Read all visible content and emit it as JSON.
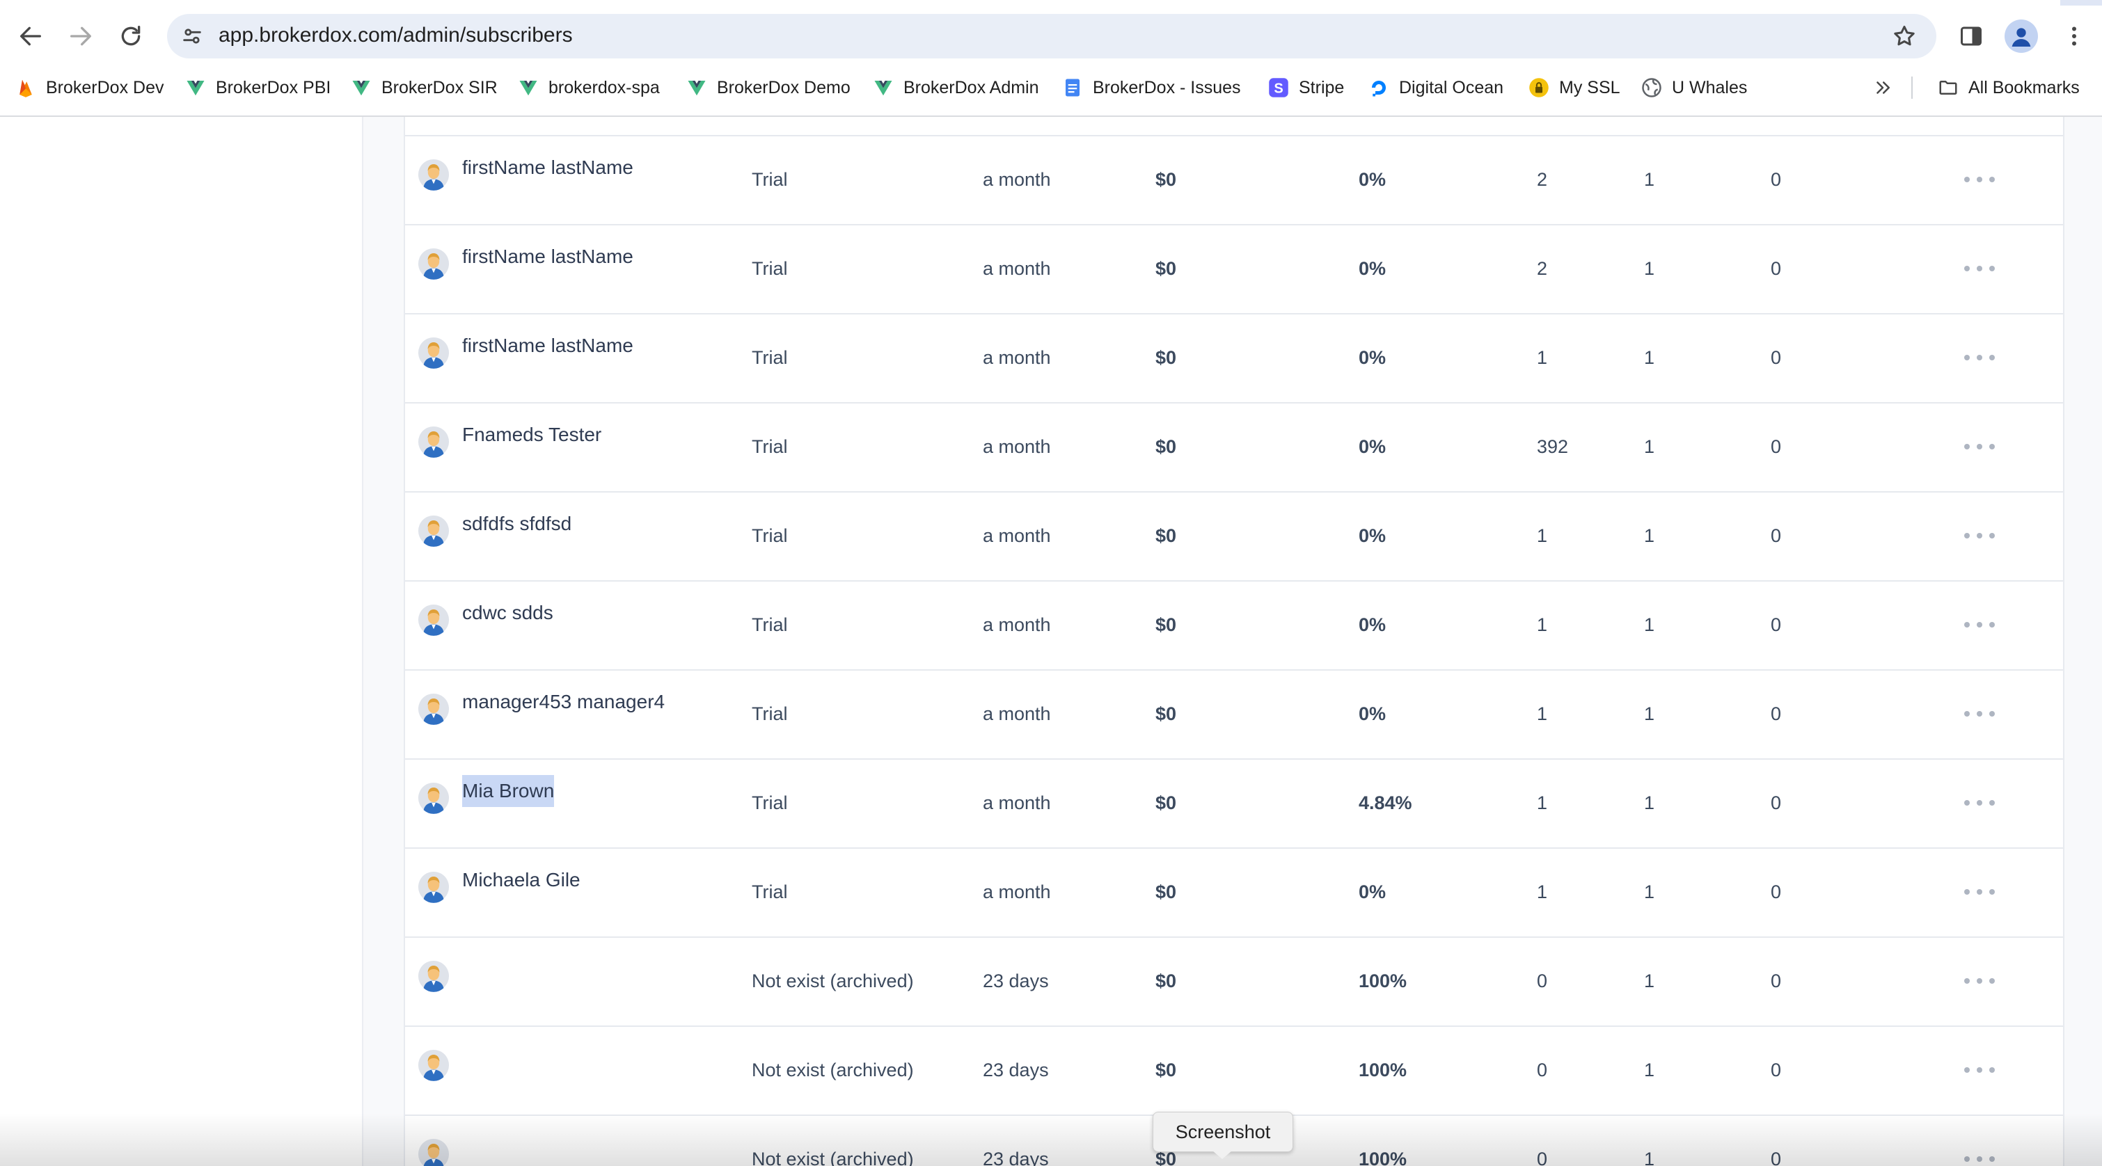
{
  "browser": {
    "url": "app.brokerdox.com/admin/subscribers",
    "bookmarks": [
      {
        "label": "BrokerDox Dev",
        "icon": "firebase-icon"
      },
      {
        "label": "BrokerDox PBI",
        "icon": "vue-icon"
      },
      {
        "label": "BrokerDox SIR",
        "icon": "vue-icon"
      },
      {
        "label": "brokerdox-spa",
        "icon": "vue-icon"
      },
      {
        "label": "BrokerDox Demo",
        "icon": "vue-icon"
      },
      {
        "label": "BrokerDox Admin",
        "icon": "vue-icon"
      },
      {
        "label": "BrokerDox - Issues",
        "icon": "google-docs-icon"
      },
      {
        "label": "Stripe",
        "icon": "stripe-icon"
      },
      {
        "label": "Digital Ocean",
        "icon": "digitalocean-icon"
      },
      {
        "label": "My SSL",
        "icon": "lock-icon"
      },
      {
        "label": "U Whales",
        "icon": "globe-icon"
      }
    ],
    "all_bookmarks_label": "All Bookmarks"
  },
  "subscribers": [
    {
      "name": "firstName lastName",
      "plan": "Trial",
      "period": "a month",
      "amount": "$0",
      "percent": "0%",
      "n1": "2",
      "n2": "1",
      "n3": "0",
      "selected": false
    },
    {
      "name": "firstName lastName",
      "plan": "Trial",
      "period": "a month",
      "amount": "$0",
      "percent": "0%",
      "n1": "2",
      "n2": "1",
      "n3": "0",
      "selected": false
    },
    {
      "name": "firstName lastName",
      "plan": "Trial",
      "period": "a month",
      "amount": "$0",
      "percent": "0%",
      "n1": "1",
      "n2": "1",
      "n3": "0",
      "selected": false
    },
    {
      "name": "Fnameds Tester",
      "plan": "Trial",
      "period": "a month",
      "amount": "$0",
      "percent": "0%",
      "n1": "392",
      "n2": "1",
      "n3": "0",
      "selected": false
    },
    {
      "name": "sdfdfs sfdfsd",
      "plan": "Trial",
      "period": "a month",
      "amount": "$0",
      "percent": "0%",
      "n1": "1",
      "n2": "1",
      "n3": "0",
      "selected": false
    },
    {
      "name": "cdwc sdds",
      "plan": "Trial",
      "period": "a month",
      "amount": "$0",
      "percent": "0%",
      "n1": "1",
      "n2": "1",
      "n3": "0",
      "selected": false
    },
    {
      "name": "manager453 manager4",
      "plan": "Trial",
      "period": "a month",
      "amount": "$0",
      "percent": "0%",
      "n1": "1",
      "n2": "1",
      "n3": "0",
      "selected": false
    },
    {
      "name": "Mia Brown",
      "plan": "Trial",
      "period": "a month",
      "amount": "$0",
      "percent": "4.84%",
      "n1": "1",
      "n2": "1",
      "n3": "0",
      "selected": true
    },
    {
      "name": "Michaela Gile",
      "plan": "Trial",
      "period": "a month",
      "amount": "$0",
      "percent": "0%",
      "n1": "1",
      "n2": "1",
      "n3": "0",
      "selected": false
    },
    {
      "name": "",
      "plan": "Not exist (archived)",
      "period": "23 days",
      "amount": "$0",
      "percent": "100%",
      "n1": "0",
      "n2": "1",
      "n3": "0",
      "selected": false
    },
    {
      "name": "",
      "plan": "Not exist (archived)",
      "period": "23 days",
      "amount": "$0",
      "percent": "100%",
      "n1": "0",
      "n2": "1",
      "n3": "0",
      "selected": false
    },
    {
      "name": "",
      "plan": "Not exist (archived)",
      "period": "23 days",
      "amount": "$0",
      "percent": "100%",
      "n1": "0",
      "n2": "1",
      "n3": "0",
      "selected": false
    }
  ],
  "tooltip": "Screenshot",
  "colors": {
    "selection": "#c9d8f5",
    "text": "#2f3b52",
    "divider": "#e6e9ee"
  }
}
